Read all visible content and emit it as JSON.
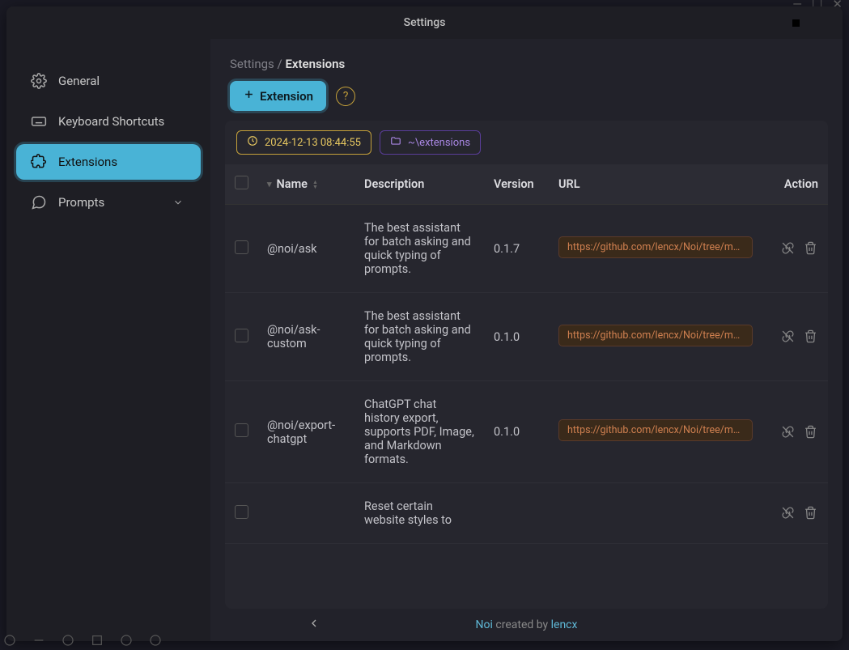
{
  "window": {
    "title": "Settings"
  },
  "sidebar": {
    "items": [
      {
        "label": "General"
      },
      {
        "label": "Keyboard Shortcuts"
      },
      {
        "label": "Extensions"
      },
      {
        "label": "Prompts"
      }
    ]
  },
  "breadcrumb": {
    "root": "Settings",
    "sep": "/",
    "current": "Extensions"
  },
  "toolbar": {
    "add_label": "Extension",
    "help": "?"
  },
  "chips": {
    "timestamp": "2024-12-13 08:44:55",
    "path": "~\\extensions"
  },
  "table": {
    "headers": {
      "name": "Name",
      "description": "Description",
      "version": "Version",
      "url": "URL",
      "action": "Action"
    },
    "rows": [
      {
        "name": "@noi/ask",
        "description": "The best assistant for batch asking and quick typing of prompts.",
        "version": "0.1.7",
        "url": "https://github.com/lencx/Noi/tree/main..."
      },
      {
        "name": "@noi/ask-custom",
        "description": "The best assistant for batch asking and quick typing of prompts.",
        "version": "0.1.0",
        "url": "https://github.com/lencx/Noi/tree/main..."
      },
      {
        "name": "@noi/export-chatgpt",
        "description": "ChatGPT chat history export, supports PDF, Image, and Markdown formats.",
        "version": "0.1.0",
        "url": "https://github.com/lencx/Noi/tree/main..."
      },
      {
        "name": "",
        "description": "Reset certain website styles to",
        "version": "",
        "url": ""
      }
    ]
  },
  "footer": {
    "brand": "Noi",
    "text": " created by ",
    "author": "lencx"
  }
}
